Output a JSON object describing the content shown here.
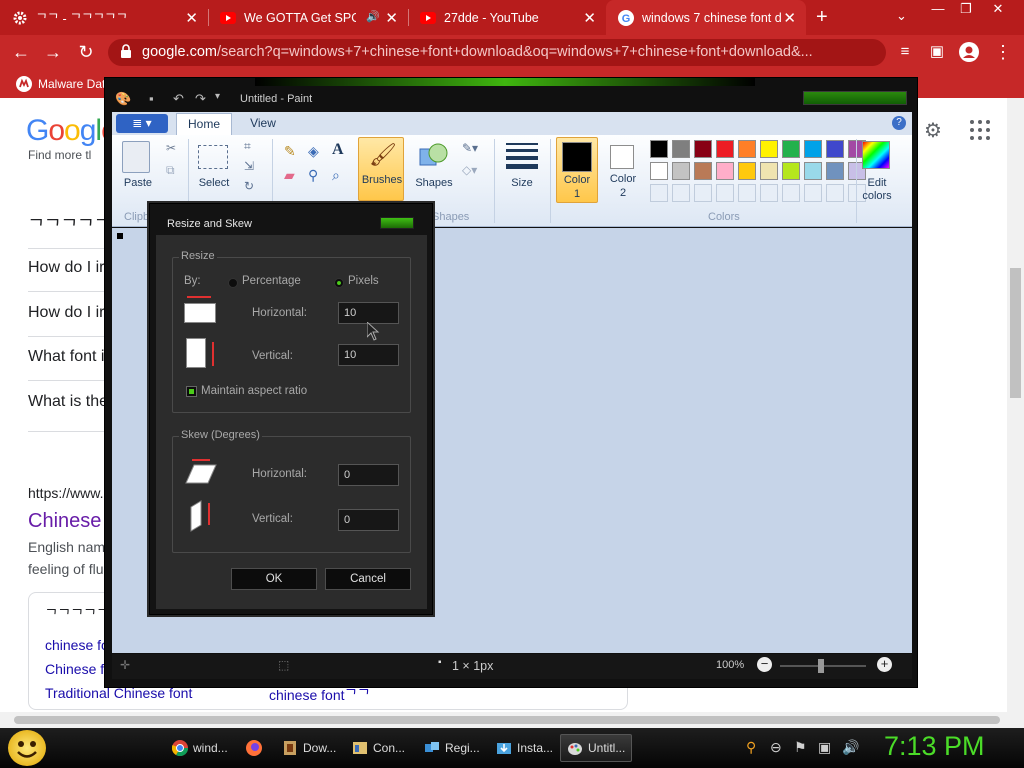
{
  "browser": {
    "tabs": [
      {
        "title": "ᄀᄀ - ᄀᄀᄀᄀᄀ",
        "favicon": "gear-icon",
        "active": false
      },
      {
        "title": "We GOTTA Get SPON",
        "favicon": "youtube-icon",
        "audio": true,
        "active": false
      },
      {
        "title": "27dde - YouTube",
        "favicon": "youtube-icon",
        "active": false
      },
      {
        "title": "windows 7 chinese font d",
        "favicon": "google-icon",
        "active": true
      }
    ],
    "url_domain": "google.com",
    "url_path": "/search?q=windows+7+chinese+font+download&oq=windows+7+chinese+font+download&...",
    "bookmark": "Malware Dat",
    "accent_color": "#c62828"
  },
  "google": {
    "logo": "Google",
    "partial_line": "Find more tl",
    "related_heading": "ᄀᄀᄀᄀᄀ",
    "questions": [
      "How do I ir",
      "How do I ir",
      "What font i",
      "What is the"
    ],
    "result_url": "https://www.",
    "result_title": "Chinese",
    "result_snippet_1": "English nam",
    "result_snippet_2": "feeling of flu",
    "box_heading": "ᄀᄀᄀᄀᄀ",
    "box_links": [
      "chinese fo",
      "Chinese f",
      "Traditional Chinese font"
    ],
    "box_link_right": "chinese fontᄀᄀ"
  },
  "paint": {
    "title": "Untitled - Paint",
    "tabs": [
      "Home",
      "View"
    ],
    "groups": [
      "Clipb",
      "Shapes",
      "Colors"
    ],
    "tools": {
      "paste": "Paste",
      "select": "Select",
      "brushes": "Brushes",
      "shapes": "Shapes",
      "size": "Size",
      "color1_line1": "Color",
      "color1_line2": "1",
      "color2_line1": "Color",
      "color2_line2": "2",
      "edit_colors_line1": "Edit",
      "edit_colors_line2": "colors"
    },
    "palette_row1": [
      "#000000",
      "#7f7f7f",
      "#880015",
      "#ed1c24",
      "#ff7f27",
      "#fff200",
      "#22b14c",
      "#00a2e8",
      "#3f48cc",
      "#a349a4"
    ],
    "palette_row2": [
      "#ffffff",
      "#c3c3c3",
      "#b97a57",
      "#ffaec9",
      "#ffc90e",
      "#efe4b0",
      "#b5e61d",
      "#99d9ea",
      "#7092be",
      "#c8bfe7"
    ],
    "status_size": "1 × 1px",
    "zoom": "100%"
  },
  "dialog": {
    "title": "Resize and Skew",
    "resize_group": "Resize",
    "by_label": "By:",
    "percentage_label": "Percentage",
    "pixels_label": "Pixels",
    "selected_unit": "Pixels",
    "resize_horizontal_label": "Horizontal:",
    "resize_horizontal_value": "10",
    "resize_vertical_label": "Vertical:",
    "resize_vertical_value": "10",
    "maintain_aspect_label": "Maintain aspect ratio",
    "maintain_aspect_checked": true,
    "skew_group": "Skew (Degrees)",
    "skew_horizontal_label": "Horizontal:",
    "skew_horizontal_value": "0",
    "skew_vertical_label": "Vertical:",
    "skew_vertical_value": "0",
    "ok_label": "OK",
    "cancel_label": "Cancel"
  },
  "taskbar": {
    "items": [
      {
        "label": "wind...",
        "icon": "chrome-icon"
      },
      {
        "label": "",
        "icon": "firefox-icon"
      },
      {
        "label": "Dow...",
        "icon": "download-icon"
      },
      {
        "label": "Con...",
        "icon": "control-panel-icon"
      },
      {
        "label": "Regi...",
        "icon": "registry-icon"
      },
      {
        "label": "Insta...",
        "icon": "installer-icon"
      },
      {
        "label": "Untitl...",
        "icon": "paint-icon"
      }
    ],
    "clock": "7:13 PM"
  }
}
